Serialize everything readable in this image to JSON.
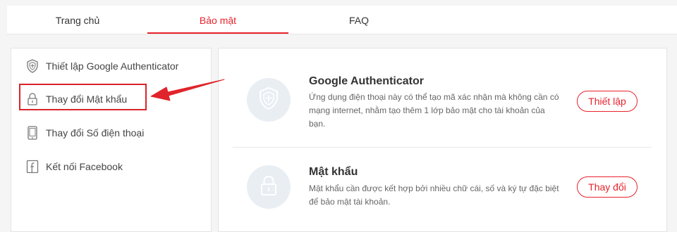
{
  "tabs": [
    {
      "label": "Trang chủ"
    },
    {
      "label": "Bảo mật"
    },
    {
      "label": "FAQ"
    }
  ],
  "active_tab": "Bảo mật",
  "sidebar": {
    "items": [
      {
        "label": "Thiết lập Google Authenticator",
        "icon": "shield-icon"
      },
      {
        "label": "Thay đổi Mật khẩu",
        "icon": "lock-icon"
      },
      {
        "label": "Thay đổi Số điện thoại",
        "icon": "phone-icon"
      },
      {
        "label": "Kết nối Facebook",
        "icon": "facebook-icon"
      }
    ]
  },
  "security": {
    "google": {
      "title": "Google Authenticator",
      "desc": "Ứng dụng điện thoại này có thể tạo mã xác nhận mà không cần có mạng internet, nhằm tạo thêm 1 lớp bảo mật cho tài khoản của bạn.",
      "button": "Thiết lập",
      "icon": "shield-icon"
    },
    "password": {
      "title": "Mật khẩu",
      "desc": "Mật khẩu cần được kết hợp bởi nhiều chữ cái, số và ký tự đặc biệt để bảo mật tài khoản.",
      "button": "Thay đổi",
      "icon": "lock-icon"
    }
  },
  "colors": {
    "accent": "#e8222b",
    "annotation": "#d9232a",
    "icon_bg": "#e9eef3"
  }
}
